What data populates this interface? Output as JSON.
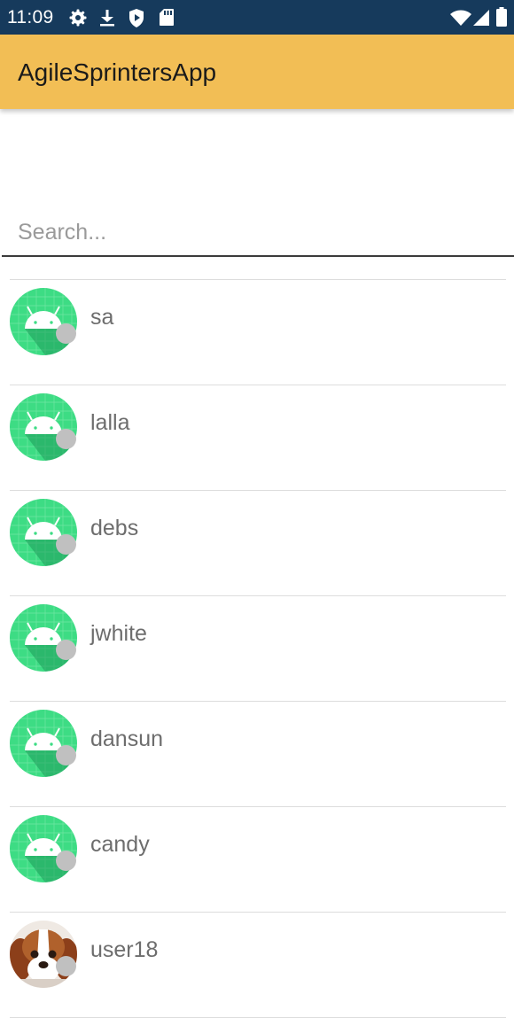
{
  "status_bar": {
    "time": "11:09",
    "left_icons": [
      "gear-icon",
      "download-icon",
      "shield-play-icon",
      "sd-card-icon"
    ],
    "right_icons": [
      "wifi-icon",
      "signal-icon",
      "battery-icon"
    ],
    "background": "#163a5c"
  },
  "app_bar": {
    "title": "AgileSprintersApp",
    "background": "#f2be55"
  },
  "search": {
    "placeholder": "Search...",
    "value": ""
  },
  "users": [
    {
      "name": "sa",
      "avatar": "android-icon",
      "status": "offline"
    },
    {
      "name": "lalla",
      "avatar": "android-icon",
      "status": "offline"
    },
    {
      "name": "debs",
      "avatar": "android-icon",
      "status": "offline"
    },
    {
      "name": "jwhite",
      "avatar": "android-icon",
      "status": "offline"
    },
    {
      "name": "dansun",
      "avatar": "android-icon",
      "status": "offline"
    },
    {
      "name": "candy",
      "avatar": "android-icon",
      "status": "offline"
    },
    {
      "name": "user18",
      "avatar": "dog-photo",
      "status": "offline"
    }
  ],
  "colors": {
    "status_offline": "#c0c0c0",
    "android_green": "#3ddc84"
  }
}
